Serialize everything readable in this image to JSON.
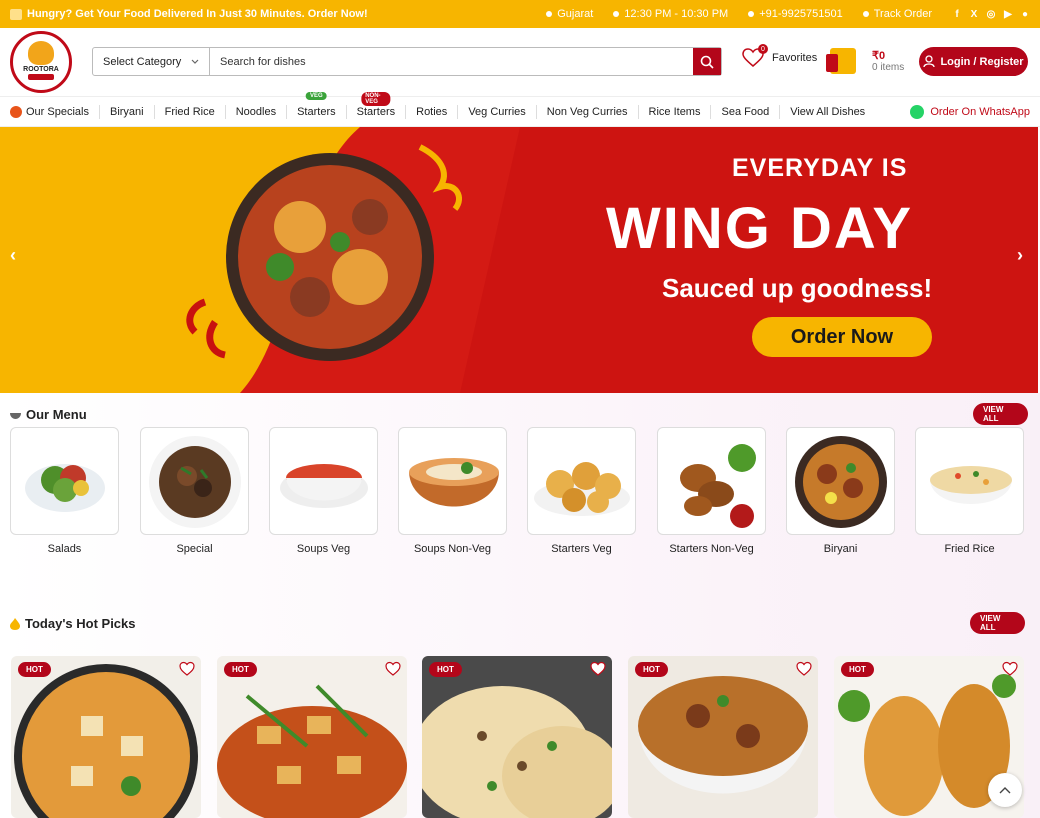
{
  "topbar": {
    "promo": "Hungry? Get Your Food Delivered In Just 30 Minutes. Order Now!",
    "location": "Gujarat",
    "hours": "12:30 PM - 10:30 PM",
    "phone": "+91-9925751501",
    "track": "Track Order",
    "social_icons": [
      "facebook-icon",
      "x-icon",
      "instagram-icon",
      "youtube-icon",
      "pinterest-icon"
    ]
  },
  "header": {
    "logo_text": "ROOTORA",
    "category_select": "Select Category",
    "search_placeholder": "Search for dishes",
    "favorites_count": "0",
    "favorites_label": "Favorites",
    "cart_total": "₹0",
    "cart_items": "0 items",
    "login_label": "Login / Register"
  },
  "nav": {
    "items": [
      {
        "label": "Our Specials"
      },
      {
        "label": "Biryani"
      },
      {
        "label": "Fried Rice"
      },
      {
        "label": "Noodles"
      },
      {
        "label": "Starters",
        "tag": "VEG"
      },
      {
        "label": "Starters",
        "tag": "NON-VEG"
      },
      {
        "label": "Roties"
      },
      {
        "label": "Veg Curries"
      },
      {
        "label": "Non Veg Curries"
      },
      {
        "label": "Rice Items"
      },
      {
        "label": "Sea Food"
      },
      {
        "label": "View All Dishes"
      }
    ],
    "whatsapp": "Order On WhatsApp"
  },
  "hero": {
    "line1": "EVERYDAY IS",
    "line2": "WING DAY",
    "line3": "Sauced up goodness!",
    "cta": "Order Now"
  },
  "menu": {
    "title": "Our Menu",
    "view_all": "VIEW ALL",
    "items": [
      "Salads",
      "Special",
      "Soups Veg",
      "Soups Non-Veg",
      "Starters Veg",
      "Starters Non-Veg",
      "Biryani",
      "Fried Rice"
    ]
  },
  "hot": {
    "title": "Today's Hot Picks",
    "view_all": "VIEW ALL",
    "badge": "HOT"
  },
  "colors": {
    "brand_red": "#b3061a",
    "brand_yellow": "#f7b500"
  }
}
